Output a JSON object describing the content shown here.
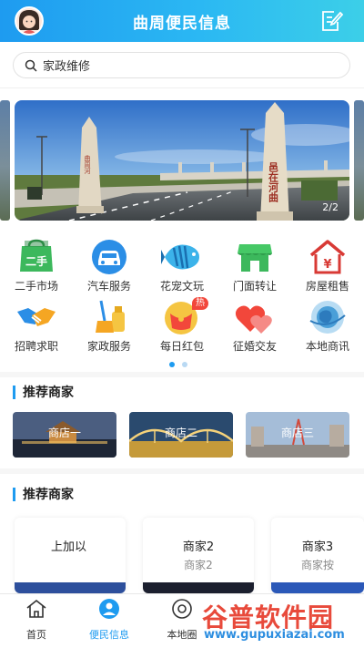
{
  "header": {
    "title": "曲周便民信息"
  },
  "search": {
    "text": "家政维修"
  },
  "banner": {
    "counter": "2/2",
    "sign_left": "曲周河",
    "sign_right": "邑在河曲"
  },
  "categories": [
    {
      "label": "二手市场",
      "icon": "second-hand-icon",
      "badge": "二手"
    },
    {
      "label": "汽车服务",
      "icon": "car-icon"
    },
    {
      "label": "花宠文玩",
      "icon": "fish-icon"
    },
    {
      "label": "门面转让",
      "icon": "shopfront-icon"
    },
    {
      "label": "房屋租售",
      "icon": "house-icon",
      "badge": "¥"
    },
    {
      "label": "招聘求职",
      "icon": "handshake-icon"
    },
    {
      "label": "家政服务",
      "icon": "cleaning-icon"
    },
    {
      "label": "每日红包",
      "icon": "red-packet-icon",
      "hot": "热"
    },
    {
      "label": "征婚交友",
      "icon": "hearts-icon"
    },
    {
      "label": "本地商讯",
      "icon": "globe-icon"
    }
  ],
  "section1": {
    "title": "推荐商家",
    "shops": [
      "商店一",
      "商店二",
      "商店三"
    ]
  },
  "section2": {
    "title": "推荐商家",
    "cards": [
      {
        "name": "上加以",
        "sub": ""
      },
      {
        "name": "商家2",
        "sub": "商家2"
      },
      {
        "name": "商家3",
        "sub": "商家按"
      }
    ]
  },
  "tabs": [
    {
      "label": "首页",
      "icon": "home-icon"
    },
    {
      "label": "便民信息",
      "icon": "service-icon"
    },
    {
      "label": "本地圈",
      "icon": "local-circle-icon"
    },
    {
      "label": "",
      "icon": ""
    },
    {
      "label": "",
      "icon": ""
    }
  ],
  "watermark": {
    "line1": "谷普软件园",
    "line2": "www.gupuxiazai.com"
  },
  "colors": {
    "primary": "#1e9bf0",
    "red": "#f2473b",
    "green": "#3cb85c"
  }
}
